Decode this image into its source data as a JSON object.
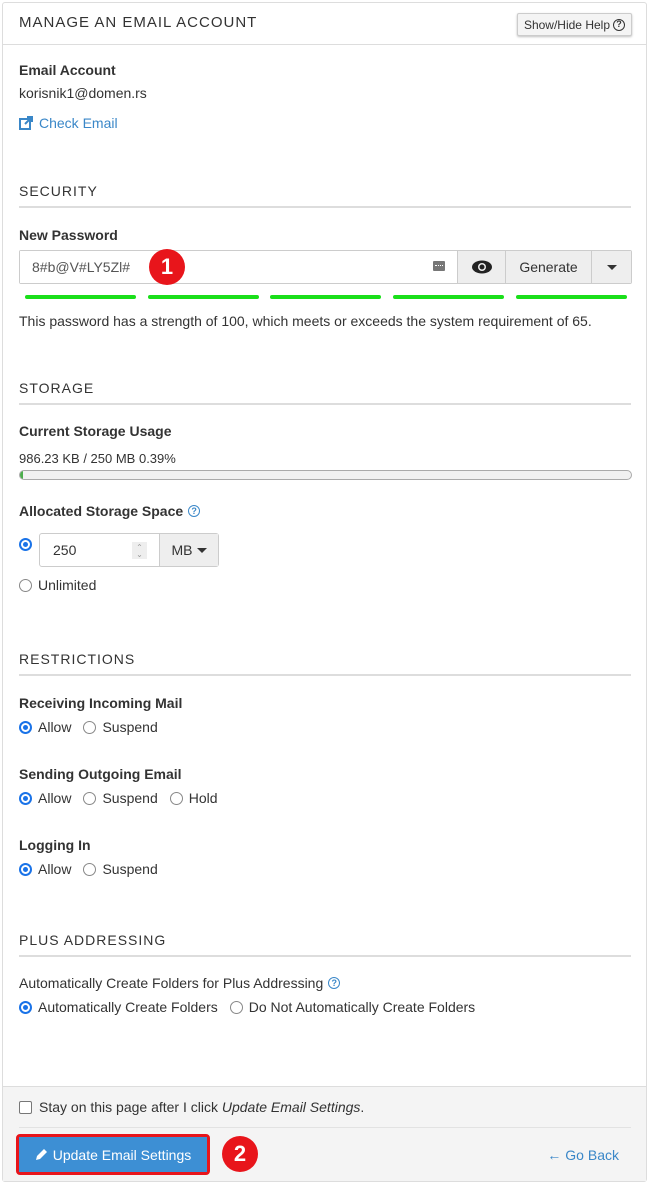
{
  "header": {
    "title": "MANAGE AN EMAIL ACCOUNT",
    "help_button": "Show/Hide Help",
    "help_icon": "question-circle-icon"
  },
  "account": {
    "label": "Email Account",
    "email": "korisnik1@domen.rs",
    "check_email_link": "Check Email",
    "check_email_icon": "external-link-icon"
  },
  "security": {
    "title": "SECURITY",
    "password_label": "New Password",
    "password_value": "8#b@V#LY5Zl#",
    "generate_label": "Generate",
    "strength_segments": 5,
    "strength": 100,
    "requirement": 65,
    "strength_message": "This password has a strength of 100, which meets or exceeds the system requirement of 65.",
    "strength_color": "#1adf1a"
  },
  "annotations": {
    "badge1": "1",
    "badge2": "2",
    "color": "#e8151b"
  },
  "storage": {
    "title": "STORAGE",
    "usage_label": "Current Storage Usage",
    "usage_text": "986.23 KB / 250 MB 0.39%",
    "usage_percent": 0.39,
    "allocated_label": "Allocated Storage Space",
    "quota_value": "250",
    "quota_unit": "MB",
    "unlimited_label": "Unlimited",
    "selected": "custom"
  },
  "restrictions": {
    "title": "RESTRICTIONS",
    "groups": [
      {
        "label": "Receiving Incoming Mail",
        "options": [
          "Allow",
          "Suspend"
        ],
        "selected": "Allow"
      },
      {
        "label": "Sending Outgoing Email",
        "options": [
          "Allow",
          "Suspend",
          "Hold"
        ],
        "selected": "Allow"
      },
      {
        "label": "Logging In",
        "options": [
          "Allow",
          "Suspend"
        ],
        "selected": "Allow"
      }
    ]
  },
  "plus_addressing": {
    "title": "PLUS ADDRESSING",
    "label": "Automatically Create Folders for Plus Addressing",
    "options": [
      "Automatically Create Folders",
      "Do Not Automatically Create Folders"
    ],
    "selected": "Automatically Create Folders"
  },
  "footer": {
    "stay_text": "Stay on this page after I click ",
    "stay_emphasis": "Update Email Settings",
    "stay_suffix": ".",
    "stay_checked": false,
    "update_button": "Update Email Settings",
    "go_back": "Go Back"
  }
}
